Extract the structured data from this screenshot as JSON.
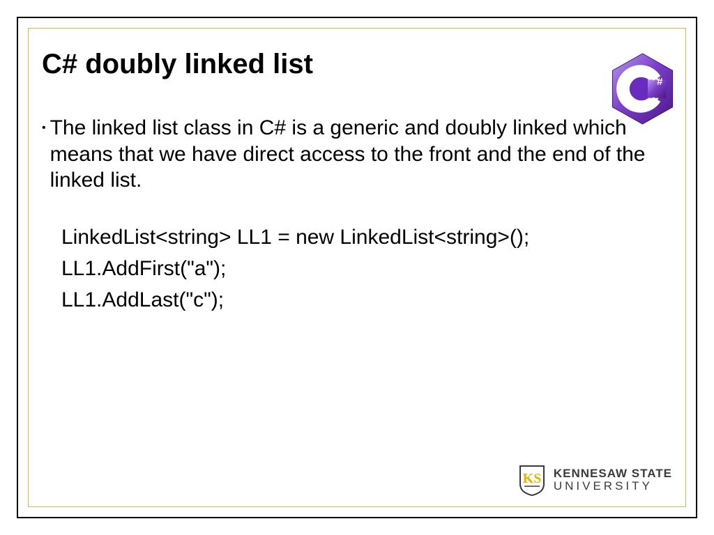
{
  "title": "C# doubly linked list",
  "bullet": "The linked list class in C# is a generic and doubly linked which means that we have direct access to the front and the end of the linked list.",
  "code": {
    "line1": "LinkedList<string> LL1 = new LinkedList<string>();",
    "line2": "LL1.AddFirst(\"a\");",
    "line3": "LL1.AddLast(\"c\");"
  },
  "logo": {
    "csharp_letter": "C",
    "csharp_hash": "#",
    "ksu_line1": "KENNESAW STATE",
    "ksu_line2": "UNIVERSITY"
  }
}
